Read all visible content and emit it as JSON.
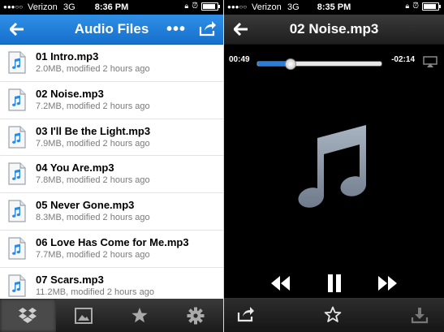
{
  "left_screen": {
    "status": {
      "carrier": "Verizon",
      "network": "3G",
      "time": "8:36 PM"
    },
    "header": {
      "title": "Audio Files",
      "back_icon": "back-arrow-icon",
      "more_label": "•••",
      "share_icon": "share-icon"
    },
    "files": [
      {
        "name": "01 Intro.mp3",
        "meta": "2.0MB, modified 2 hours ago"
      },
      {
        "name": "02 Noise.mp3",
        "meta": "7.2MB, modified 2 hours ago"
      },
      {
        "name": "03 I'll Be the Light.mp3",
        "meta": "7.9MB, modified 2 hours ago"
      },
      {
        "name": "04 You Are.mp3",
        "meta": "7.8MB, modified 2 hours ago"
      },
      {
        "name": "05 Never Gone.mp3",
        "meta": "8.3MB, modified 2 hours ago"
      },
      {
        "name": "06 Love Has Come for Me.mp3",
        "meta": "7.7MB, modified 2 hours ago"
      },
      {
        "name": "07 Scars.mp3",
        "meta": "11.2MB, modified 2 hours ago"
      }
    ],
    "tabs": [
      {
        "icon": "dropbox-icon",
        "active": true
      },
      {
        "icon": "photos-icon",
        "active": false
      },
      {
        "icon": "favorites-star-icon",
        "active": false
      },
      {
        "icon": "settings-gear-icon",
        "active": false
      }
    ]
  },
  "right_screen": {
    "status": {
      "carrier": "Verizon",
      "network": "3G",
      "time": "8:35 PM"
    },
    "header": {
      "title": "02 Noise.mp3",
      "back_icon": "back-arrow-icon"
    },
    "player": {
      "elapsed": "00:49",
      "remaining": "-02:14",
      "progress": 0.27
    },
    "controls": [
      "rewind-icon",
      "pause-icon",
      "fast-forward-icon"
    ],
    "bottom_actions": [
      "share-icon",
      "favorite-star-icon",
      "download-icon"
    ]
  },
  "colors": {
    "accent": "#1b78d6",
    "track": "#2a7ed8"
  }
}
